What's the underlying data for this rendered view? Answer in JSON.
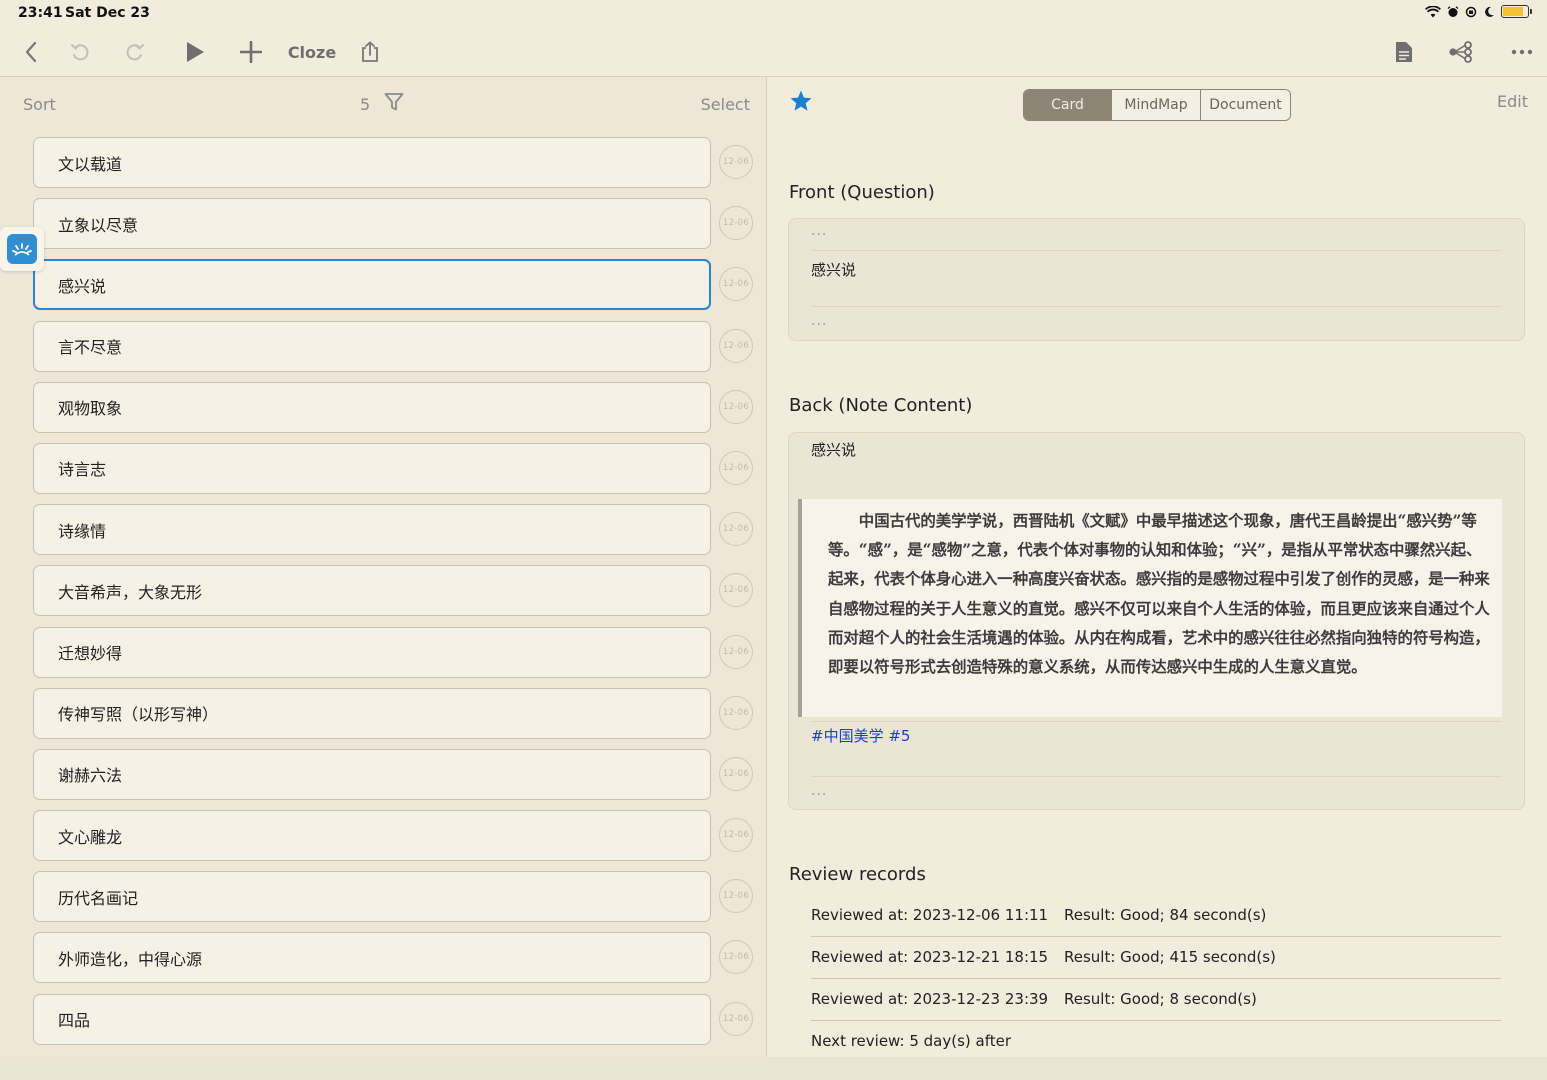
{
  "status_bar": {
    "time": "23:41",
    "date": "Sat Dec 23"
  },
  "toolbar": {
    "cloze_label": "Cloze"
  },
  "list_header": {
    "sort_label": "Sort",
    "count": "5",
    "select_label": "Select"
  },
  "cards": [
    {
      "title": "文以载道",
      "date": "12-06"
    },
    {
      "title": "立象以尽意",
      "date": "12-06"
    },
    {
      "title": "感兴说",
      "date": "12-06",
      "active": true
    },
    {
      "title": "言不尽意",
      "date": "12-06"
    },
    {
      "title": "观物取象",
      "date": "12-06"
    },
    {
      "title": "诗言志",
      "date": "12-06"
    },
    {
      "title": "诗缘情",
      "date": "12-06"
    },
    {
      "title": "大音希声，大象无形",
      "date": "12-06"
    },
    {
      "title": "迁想妙得",
      "date": "12-06"
    },
    {
      "title": "传神写照（以形写神）",
      "date": "12-06"
    },
    {
      "title": "谢赫六法",
      "date": "12-06"
    },
    {
      "title": "文心雕龙",
      "date": "12-06"
    },
    {
      "title": "历代名画记",
      "date": "12-06"
    },
    {
      "title": "外师造化，中得心源",
      "date": "12-06"
    },
    {
      "title": "四品",
      "date": "12-06"
    }
  ],
  "detail": {
    "tabs": [
      "Card",
      "MindMap",
      "Document"
    ],
    "active_tab": "Card",
    "edit_label": "Edit",
    "front_title": "Front (Question)",
    "front_dots_top": "...",
    "front_text": "感兴说",
    "front_dots_bottom": "...",
    "back_title": "Back (Note Content)",
    "back_heading": "感兴说",
    "back_quote": "中国古代的美学学说，西晋陆机《文赋》中最早描述这个现象，唐代王昌龄提出“感兴势”等等。“感”，是“感物”之意，代表个体对事物的认知和体验；“兴”，是指从平常状态中骤然兴起、起来，代表个体身心进入一种高度兴奋状态。感兴指的是感物过程中引发了创作的灵感，是一种来自感物过程的关于人生意义的直觉。感兴不仅可以来自个人生活的体验，而且更应该来自通过个人而对超个人的社会生活境遇的体验。从内在构成看，艺术中的感兴往往必然指向独特的符号构造，即要以符号形式去创造特殊的意义系统，从而传达感兴中生成的人生意义直觉。",
    "back_tags": "#中国美学 #5",
    "back_dots": "...",
    "review_title": "Review records",
    "reviews": [
      {
        "at": "Reviewed at: 2023-12-06 11:11",
        "result": "Result: Good; 84 second(s)"
      },
      {
        "at": "Reviewed at: 2023-12-21 18:15",
        "result": "Result: Good; 415 second(s)"
      },
      {
        "at": "Reviewed at: 2023-12-23 23:39",
        "result": "Result: Good; 8 second(s)"
      }
    ],
    "next_review": "Next review: 5 day(s) after"
  },
  "colors": {
    "accent": "#2b83d6",
    "star": "#1a7fd0",
    "tag": "#1b3fd1",
    "background": "#f2ecdd"
  }
}
